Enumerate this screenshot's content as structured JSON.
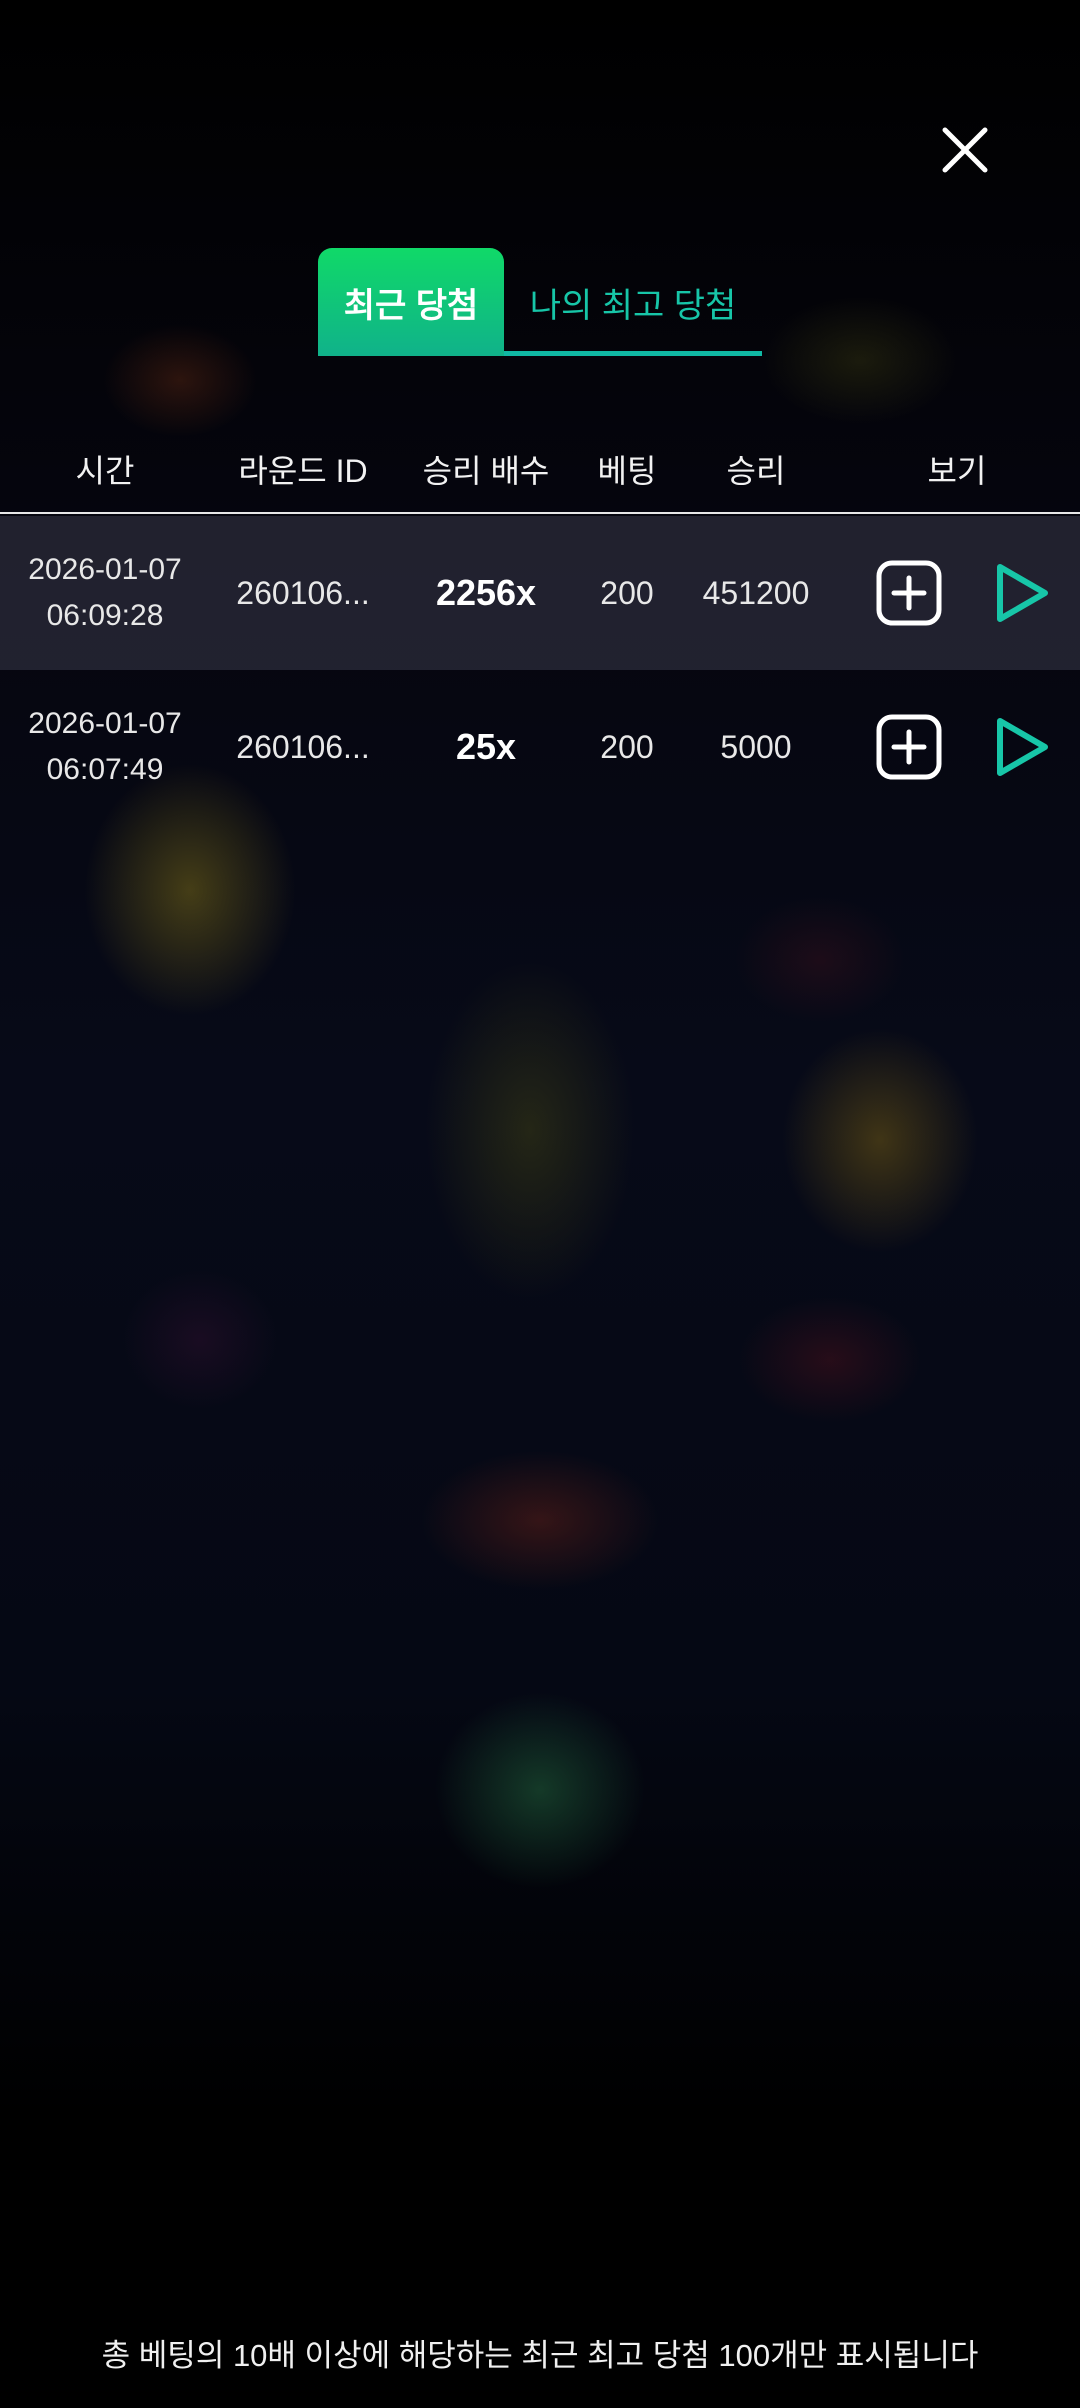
{
  "colors": {
    "accent_gradient_top": "#10d968",
    "accent_gradient_bottom": "#10b28a",
    "accent_teal": "#17c6a8",
    "background": "#000000"
  },
  "icons": {
    "close": "close-icon",
    "add": "plus-square-icon",
    "play": "play-icon"
  },
  "tabs": {
    "recent_wins": "최근 당첨",
    "my_best_wins": "나의 최고 당첨",
    "active": "recent_wins"
  },
  "table": {
    "headers": {
      "time": "시간",
      "round_id": "라운드 ID",
      "multiplier": "승리 배수",
      "bet": "베팅",
      "win": "승리",
      "view": "보기"
    },
    "rows": [
      {
        "date": "2026-01-07",
        "time": "06:09:28",
        "round_id": "260106...",
        "multiplier": "2256x",
        "bet": "200",
        "win": "451200"
      },
      {
        "date": "2026-01-07",
        "time": "06:07:49",
        "round_id": "260106...",
        "multiplier": "25x",
        "bet": "200",
        "win": "5000"
      }
    ]
  },
  "footer": {
    "note": "총 베팅의 10배 이상에 해당하는 최근 최고 당첨 100개만 표시됩니다"
  }
}
